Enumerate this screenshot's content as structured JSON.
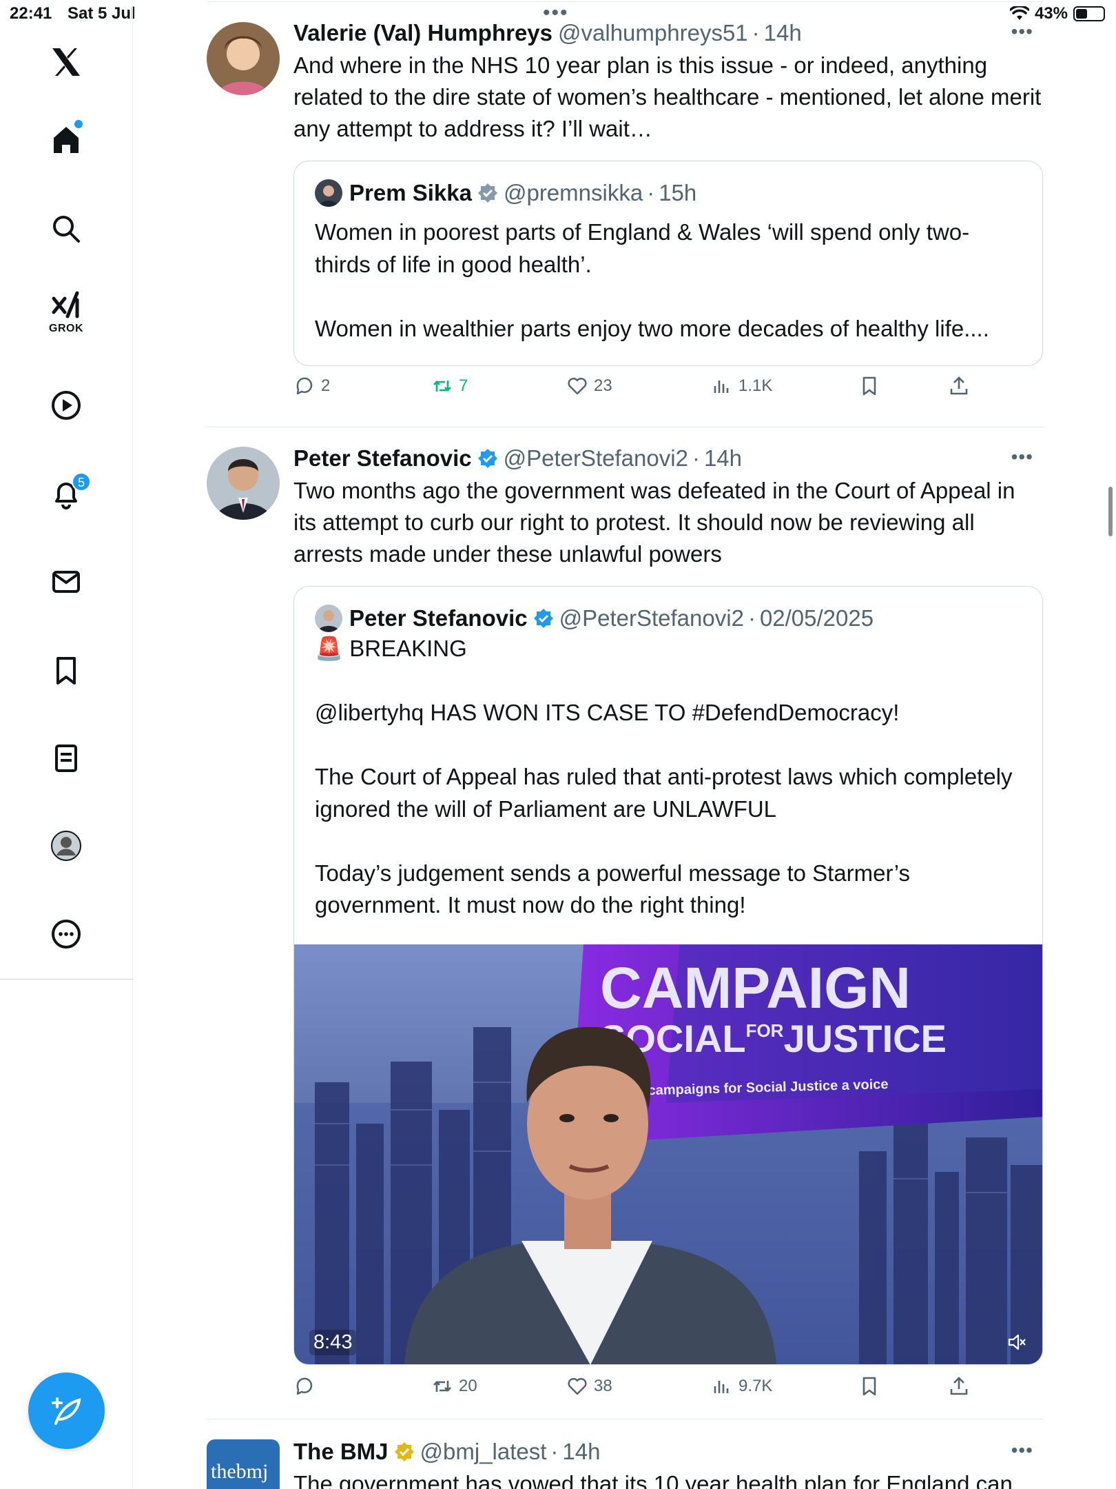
{
  "status_bar": {
    "time": "22:41",
    "date": "Sat 5 Jul",
    "battery": "43%",
    "battery_level": 0.43
  },
  "sidebar": {
    "grok_label": "GROK",
    "notifications_count": "5"
  },
  "tweets": [
    {
      "name": "Valerie (Val) Humphreys",
      "handle": "@valhumphreys51",
      "time": "14h",
      "text": "And where in the NHS 10 year plan is this issue - or indeed, anything related to the dire state of women’s healthcare - mentioned, let alone merit any attempt to address it? I’ll wait…",
      "quote": {
        "name": "Prem Sikka",
        "handle": "@premnsikka",
        "time": "15h",
        "text": "Women in poorest parts of England & Wales ‘will spend only two-thirds of life in good health’.\n\nWomen in wealthier parts enjoy two more decades of healthy life...."
      },
      "actions": {
        "replies": "2",
        "retweets": "7",
        "likes": "23",
        "views": "1.1K"
      }
    },
    {
      "name": "Peter Stefanovic",
      "handle": "@PeterStefanovi2",
      "time": "14h",
      "text": "Two months ago the government was defeated in the Court of Appeal in its attempt to curb our right to protest. It should now be reviewing all arrests made under these unlawful powers",
      "quote": {
        "name": "Peter Stefanovic",
        "handle": "@PeterStefanovi2",
        "time": "02/05/2025",
        "text": "🚨 BREAKING\n\n@libertyhq  HAS WON ITS CASE TO #DefendDemocracy!\n\nThe Court of Appeal has ruled that anti-protest laws which completely ignored the will of Parliament are UNLAWFUL\n\nToday’s judgement sends a powerful message to Starmer’s government. It must now do the right thing!",
        "media": {
          "banner_line1": "CAMPAIGN",
          "banner_line2a": "SOCIAL",
          "banner_for": "FOR",
          "banner_line2b": "JUSTICE",
          "banner_tagline": "Giving campaigns for Social Justice a voice",
          "duration": "8:43"
        }
      },
      "actions": {
        "replies": "",
        "retweets": "20",
        "likes": "38",
        "views": "9.7K"
      }
    },
    {
      "name": "The BMJ",
      "handle": "@bmj_latest",
      "time": "14h",
      "avatar_text": "thebmj",
      "text": "The government has vowed that its 10 year health plan for England can"
    }
  ],
  "colors": {
    "accent": "#1d9bf0",
    "retweet_green": "#00ba7c",
    "muted": "#536471",
    "gold_check": "#e2b719"
  }
}
